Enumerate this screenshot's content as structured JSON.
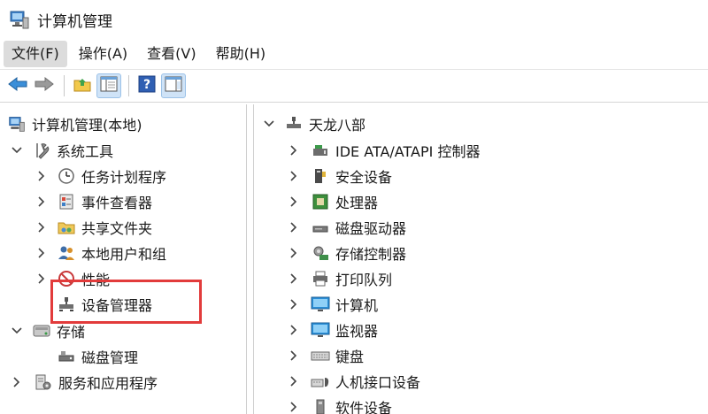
{
  "window": {
    "title": "计算机管理"
  },
  "menu": [
    {
      "label": "文件(F)",
      "active": true
    },
    {
      "label": "操作(A)"
    },
    {
      "label": "查看(V)"
    },
    {
      "label": "帮助(H)"
    }
  ],
  "toolbar": {
    "buttons": [
      "back-arrow-icon",
      "forward-arrow-icon",
      "up-folder-icon",
      "show-tree-icon",
      "help-icon",
      "action-pane-icon"
    ]
  },
  "tree": {
    "root": "计算机管理(本地)",
    "system_tools": "系统工具",
    "task_scheduler": "任务计划程序",
    "event_viewer": "事件查看器",
    "shared_folders": "共享文件夹",
    "local_users": "本地用户和组",
    "performance": "性能",
    "device_manager": "设备管理器",
    "storage": "存储",
    "disk_management": "磁盘管理",
    "services_apps": "服务和应用程序"
  },
  "devices": {
    "computer_name": "天龙八部",
    "items": [
      "IDE ATA/ATAPI 控制器",
      "安全设备",
      "处理器",
      "磁盘驱动器",
      "存储控制器",
      "打印队列",
      "计算机",
      "监视器",
      "键盘",
      "人机接口设备",
      "软件设备"
    ]
  },
  "colors": {
    "highlight": "#e23b3b",
    "selected_button": "#cfe3f7"
  }
}
